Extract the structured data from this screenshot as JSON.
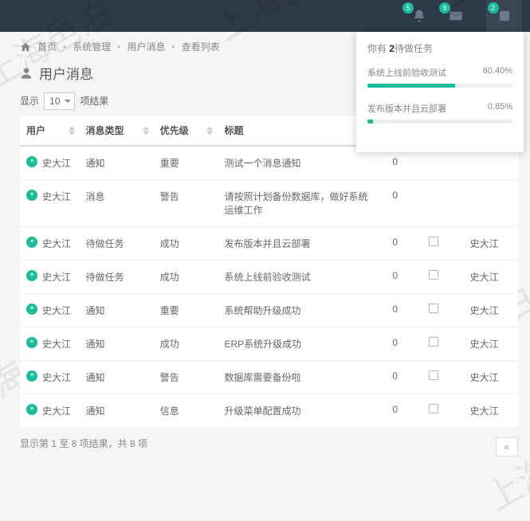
{
  "watermark": "上海邑泊",
  "topbar": {
    "badges": [
      "5",
      "9",
      "2"
    ]
  },
  "breadcrumb": {
    "home": "首页",
    "sys": "系统管理",
    "msg": "用户消息",
    "list": "查看列表"
  },
  "page": {
    "title": "用户消息"
  },
  "length": {
    "show": "显示",
    "value": "10",
    "unit": "项结果"
  },
  "table": {
    "headers": {
      "user": "用户",
      "type": "消息类型",
      "priority": "优先级",
      "title": "标题",
      "owner": ""
    },
    "rows": [
      {
        "user": "史大江",
        "type": "通知",
        "priority": "重要",
        "title": "测试一个消息通知",
        "num": "0",
        "owner": ""
      },
      {
        "user": "史大江",
        "type": "消息",
        "priority": "警告",
        "title": "请按照计划备份数据库，做好系统运维工作",
        "num": "0",
        "owner": ""
      },
      {
        "user": "史大江",
        "type": "待做任务",
        "priority": "成功",
        "title": "发布版本并且云部署",
        "num": "0",
        "owner": "史大江"
      },
      {
        "user": "史大江",
        "type": "待做任务",
        "priority": "成功",
        "title": "系统上线前验收测试",
        "num": "0",
        "owner": "史大江"
      },
      {
        "user": "史大江",
        "type": "通知",
        "priority": "重要",
        "title": "系统帮助升级成功",
        "num": "0",
        "owner": "史大江"
      },
      {
        "user": "史大江",
        "type": "通知",
        "priority": "成功",
        "title": "ERP系统升级成功",
        "num": "0",
        "owner": "史大江"
      },
      {
        "user": "史大江",
        "type": "通知",
        "priority": "警告",
        "title": "数据库需要备份啦",
        "num": "0",
        "owner": "史大江"
      },
      {
        "user": "史大江",
        "type": "通知",
        "priority": "信息",
        "title": "升级菜单配置成功",
        "num": "0",
        "owner": "史大江"
      }
    ]
  },
  "info": "显示第 1 至 8 项结果，共 8 项",
  "pager": {
    "prev": "«"
  },
  "panel": {
    "prefix": "你有 ",
    "count": "2",
    "suffix": "待做任务",
    "tasks": [
      {
        "name": "系统上线前验收测试",
        "pct": "60.40%",
        "width": 60.4
      },
      {
        "name": "发布版本并且云部署",
        "pct": "0.85%",
        "width": 4
      }
    ]
  }
}
